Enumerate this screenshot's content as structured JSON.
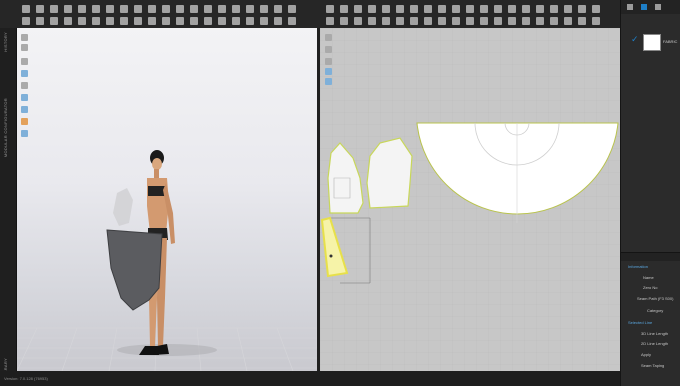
{
  "side_tabs": [
    "HISTORY",
    "MODULAR CONFIGURATOR",
    "LIBRARY"
  ],
  "object_browser": {
    "item_label": "FABRIC",
    "checked": true
  },
  "property_editor": {
    "sections": [
      {
        "header": "Information",
        "rows": [
          "Name",
          "Zero No",
          "Seam Path (F3 S00)",
          "Category"
        ]
      },
      {
        "header": "Selected Line",
        "rows": [
          "3D Line Length",
          "2D Line Length",
          "Apply",
          "Seam Taping"
        ]
      }
    ]
  },
  "status": {
    "text": "Version: 7.0.128 (76953)"
  },
  "colors": {
    "accent": "#1e7fc7",
    "pattern_outline": "#c8d75a",
    "selection": "#e7e04a"
  }
}
